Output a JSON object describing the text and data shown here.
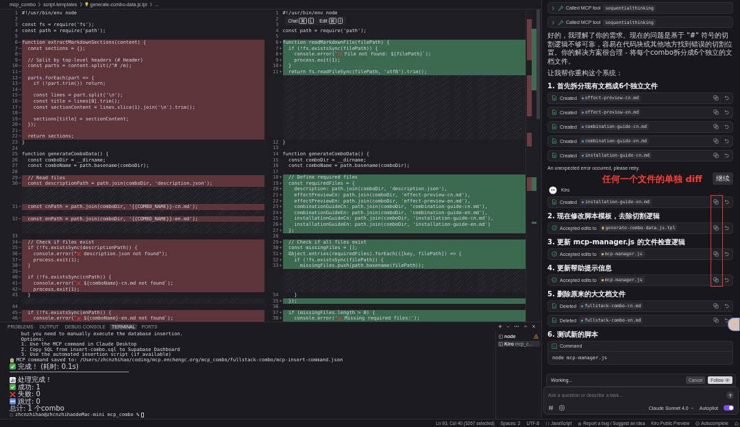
{
  "breadcrumb": [
    {
      "label": "mcp_combo",
      "kind": "folder"
    },
    {
      "label": "script-templates",
      "kind": "folder"
    },
    {
      "label": "generate-combo-data.js.tpl",
      "kind": "file"
    },
    {
      "label": "...",
      "kind": "more"
    }
  ],
  "diff": {
    "hint": [
      {
        "label": "Chat",
        "keys": [
          "⌘",
          "L"
        ]
      },
      {
        "label": "Edit",
        "keys": [
          "⌘",
          "I"
        ]
      }
    ],
    "rows": [
      {
        "left": {
          "num": "1",
          "kind": "same",
          "code": "#!/usr/bin/env node"
        },
        "right": {
          "num": "1",
          "kind": "same",
          "code": "#!/usr/bin/env node"
        }
      },
      {
        "left": {
          "num": "2",
          "kind": "same"
        },
        "right": {
          "num": "2",
          "kind": "same"
        }
      },
      {
        "left": {
          "num": "3",
          "kind": "same",
          "code": "const fs = require('fs');"
        },
        "right": {
          "num": "3",
          "kind": "same"
        }
      },
      {
        "left": {
          "num": "4",
          "kind": "same",
          "code": "const path = require('path');"
        },
        "right": {
          "num": "4",
          "kind": "same",
          "code": "const path = require('path');"
        }
      },
      {
        "left": {
          "num": "5",
          "kind": "same"
        },
        "right": {
          "num": "5",
          "kind": "same"
        }
      },
      {
        "left": {
          "num": "6",
          "sign": "−",
          "kind": "del",
          "code": "function extractMarkdownSections(content) {"
        },
        "right": {
          "num": "6",
          "sign": "+",
          "kind": "add",
          "code": "function readMarkdownFile(filePath) {"
        }
      },
      {
        "left": {
          "num": "7",
          "sign": "−",
          "kind": "del",
          "code": "  const sections = {};"
        },
        "right": {
          "num": "7",
          "sign": "+",
          "kind": "add",
          "code": "  if (!fs.existsSync(filePath)) {"
        }
      },
      {
        "left": {
          "num": "8",
          "sign": "−",
          "kind": "del"
        },
        "right": {
          "num": "8",
          "sign": "+",
          "kind": "add",
          "code": [
            "    console.error(`",
            " File not found: ${filePath}`);"
          ]
        }
      },
      {
        "left": {
          "num": "9",
          "sign": "−",
          "kind": "del",
          "code": "  // Split by top-level headers (# Header)"
        },
        "right": {
          "num": "9",
          "sign": "+",
          "kind": "add",
          "code": "    process.exit(1);"
        }
      },
      {
        "left": {
          "num": "10",
          "sign": "−",
          "kind": "del",
          "code": "  const parts = content.split(/^# /m);"
        },
        "right": {
          "num": "10",
          "sign": "+",
          "kind": "add",
          "code": "  }"
        }
      },
      {
        "left": {
          "num": "11",
          "sign": "−",
          "kind": "del"
        },
        "right": {
          "num": "11",
          "sign": "+",
          "kind": "add",
          "code": "  return fs.readFileSync(filePath, 'utf8').trim();"
        }
      },
      {
        "left": {
          "num": "12",
          "sign": "−",
          "kind": "del",
          "code": "  parts.forEach(part => {"
        },
        "right": null
      },
      {
        "left": {
          "num": "13",
          "sign": "−",
          "kind": "del",
          "code": "    if (!part.trim()) return;"
        },
        "right": null
      },
      {
        "left": {
          "num": "14",
          "sign": "−",
          "kind": "del"
        },
        "right": null
      },
      {
        "left": {
          "num": "15",
          "sign": "−",
          "kind": "del",
          "code": "    const lines = part.split('\\n');"
        },
        "right": null
      },
      {
        "left": {
          "num": "16",
          "sign": "−",
          "kind": "del",
          "code": "    const title = lines[0].trim();"
        },
        "right": null
      },
      {
        "left": {
          "num": "17",
          "sign": "−",
          "kind": "del",
          "code": "    const sectionContent = lines.slice(1).join('\\n').trim();"
        },
        "right": null
      },
      {
        "left": {
          "num": "18",
          "sign": "−",
          "kind": "del"
        },
        "right": null
      },
      {
        "left": {
          "num": "19",
          "sign": "−",
          "kind": "del",
          "code": "    sections[title] = sectionContent;"
        },
        "right": null
      },
      {
        "left": {
          "num": "20",
          "sign": "−",
          "kind": "del",
          "code": "  });"
        },
        "right": null
      },
      {
        "left": {
          "num": "21",
          "sign": "−",
          "kind": "del"
        },
        "right": null
      },
      {
        "left": {
          "num": "22",
          "sign": "−",
          "kind": "del",
          "code": "  return sections;"
        },
        "right": null
      },
      {
        "left": {
          "num": "23",
          "kind": "same",
          "code": "}"
        },
        "right": {
          "num": "12",
          "kind": "same",
          "code": "}"
        }
      },
      {
        "left": {
          "num": "24",
          "kind": "same"
        },
        "right": {
          "num": "13",
          "kind": "same"
        }
      },
      {
        "left": {
          "num": "25",
          "kind": "same",
          "code": "function generateComboData() {"
        },
        "right": {
          "num": "14",
          "kind": "same",
          "code": "function generateComboData() {"
        }
      },
      {
        "left": {
          "num": "26",
          "kind": "same",
          "code": "  const comboDir = __dirname;"
        },
        "right": {
          "num": "15",
          "kind": "same",
          "code": "  const comboDir = __dirname;"
        }
      },
      {
        "left": {
          "num": "27",
          "kind": "same",
          "code": "  const comboName = path.basename(comboDir);"
        },
        "right": {
          "num": "16",
          "kind": "same",
          "code": "  const comboName = path.basename(comboDir);"
        }
      },
      {
        "left": {
          "num": "28",
          "kind": "same"
        },
        "right": {
          "num": "17",
          "kind": "same"
        }
      },
      {
        "left": {
          "num": "29",
          "sign": "−",
          "kind": "del",
          "code": "  // Read files"
        },
        "right": {
          "num": "18",
          "sign": "+",
          "kind": "add",
          "code": "  // Define required files"
        }
      },
      {
        "left": {
          "num": "30",
          "sign": "−",
          "kind": "del",
          "code": "  const descriptionPath = path.join(comboDir, 'description.json');"
        },
        "right": {
          "num": "19",
          "sign": "+",
          "kind": "add",
          "code": "  const requiredFiles = {"
        }
      },
      {
        "left": null,
        "right": {
          "num": "20",
          "sign": "+",
          "kind": "add",
          "code": "    description: path.join(comboDir, 'description.json'),"
        }
      },
      {
        "left": null,
        "right": {
          "num": "21",
          "sign": "+",
          "kind": "add",
          "code": "    effectPreviewCn: path.join(comboDir, 'effect-preview-cn.md'),"
        }
      },
      {
        "left": null,
        "right": {
          "num": "22",
          "sign": "+",
          "kind": "add",
          "code": "    effectPreviewEn: path.join(comboDir, 'effect-preview-en.md'),"
        }
      },
      {
        "left": {
          "num": "31",
          "sign": "−",
          "kind": "del",
          "code": "  const cnPath = path.join(comboDir, '{{COMBO_NAME}}-cn.md');"
        },
        "right": {
          "num": "23",
          "sign": "+",
          "kind": "add",
          "code": "    combinationGuideCn: path.join(comboDir, 'combination-guide-cn.md'),"
        }
      },
      {
        "left": null,
        "right": {
          "num": "24",
          "sign": "+",
          "kind": "add",
          "code": "    combinationGuideEn: path.join(comboDir, 'combination-guide-en.md'),"
        }
      },
      {
        "left": {
          "num": "32",
          "sign": "−",
          "kind": "del",
          "code": "  const enPath = path.join(comboDir, '{{COMBO_NAME}}-en.md');"
        },
        "right": {
          "num": "25",
          "sign": "+",
          "kind": "add",
          "code": "    installationGuideCn: path.join(comboDir, 'installation-guide-cn.md'),"
        }
      },
      {
        "left": null,
        "right": {
          "num": "26",
          "sign": "+",
          "kind": "add",
          "code": "    installationGuideEn: path.join(comboDir, 'installation-guide-en.md')"
        }
      },
      {
        "left": null,
        "right": {
          "num": "27",
          "sign": "+",
          "kind": "add",
          "code": "  };"
        }
      },
      {
        "left": {
          "num": "33",
          "kind": "same"
        },
        "right": {
          "num": "28",
          "kind": "same"
        }
      },
      {
        "left": {
          "num": "34",
          "sign": "−",
          "kind": "del",
          "code": "  // Check if files exist"
        },
        "right": {
          "num": "29",
          "sign": "+",
          "kind": "add",
          "code": "  // Check if all files exist"
        }
      },
      {
        "left": {
          "num": "35",
          "sign": "−",
          "kind": "del",
          "code": "  if (!fs.existsSync(descriptionPath)) {"
        },
        "right": {
          "num": "30",
          "sign": "+",
          "kind": "add",
          "code": "  const missingFiles = [];"
        }
      },
      {
        "left": {
          "num": "36",
          "sign": "−",
          "kind": "del",
          "code": [
            "    console.error(\"",
            " description.json not found\");"
          ]
        },
        "right": {
          "num": "31",
          "sign": "+",
          "kind": "add",
          "code": "  Object.entries(requiredFiles).forEach(([key, filePath]) => {"
        }
      },
      {
        "left": {
          "num": "37",
          "sign": "−",
          "kind": "del",
          "code": "    process.exit(1);"
        },
        "right": {
          "num": "32",
          "sign": "+",
          "kind": "add",
          "code": "    if (!fs.existsSync(filePath)) {"
        }
      },
      {
        "left": {
          "num": "38",
          "sign": "−",
          "kind": "del",
          "code": "  }"
        },
        "right": {
          "num": "33",
          "sign": "+",
          "kind": "add",
          "code": "      missingFiles.push(path.basename(filePath));"
        }
      },
      {
        "left": {
          "num": "39",
          "sign": "−",
          "kind": "del"
        },
        "right": null
      },
      {
        "left": {
          "num": "40",
          "sign": "−",
          "kind": "del",
          "code": "  if (!fs.existsSync(cnPath)) {"
        },
        "right": null
      },
      {
        "left": {
          "num": "41",
          "sign": "−",
          "kind": "del",
          "code": [
            "    console.error(`",
            " ${comboName}-cn.md not found`);"
          ]
        },
        "right": null
      },
      {
        "left": {
          "num": "42",
          "sign": "−",
          "kind": "del",
          "code": "    process.exit(1);"
        },
        "right": null
      },
      {
        "left": {
          "num": "43",
          "kind": "same",
          "code": "  }"
        },
        "right": {
          "num": "34",
          "kind": "same",
          "code": "    }"
        }
      },
      {
        "left": null,
        "right": {
          "num": "35",
          "sign": "+",
          "kind": "add",
          "code": "  });"
        }
      },
      {
        "left": {
          "num": "44",
          "kind": "same"
        },
        "right": {
          "num": "36",
          "kind": "same"
        }
      },
      {
        "left": {
          "num": "45",
          "sign": "−",
          "kind": "del",
          "code": "  if (!fs.existsSync(enPath)) {"
        },
        "right": {
          "num": "37",
          "sign": "+",
          "kind": "add",
          "code": "  if (missingFiles.length > 0) {"
        }
      },
      {
        "left": {
          "num": "46",
          "sign": "−",
          "kind": "del",
          "code": [
            "    console.error(`",
            " ${comboName}-en.md not found`);"
          ]
        },
        "right": {
          "num": "38",
          "sign": "+",
          "kind": "add",
          "code": [
            "    console.error('",
            " Missing required files:');"
          ]
        }
      }
    ]
  },
  "terminal": {
    "tabs": [
      {
        "label": "PROBLEMS",
        "selected": false
      },
      {
        "label": "OUTPUT",
        "selected": false
      },
      {
        "label": "DEBUG CONSOLE",
        "selected": false
      },
      {
        "label": "TERMINAL",
        "selected": true
      },
      {
        "label": "PORTS",
        "selected": false
      }
    ],
    "lines": [
      {
        "kind": "output",
        "text": "    but you need to manually execute the database insertion."
      },
      {
        "kind": "output",
        "text": "    Options:"
      },
      {
        "kind": "output",
        "text": "    1. Use the MCP command in Claude Desktop"
      },
      {
        "kind": "output",
        "text": "    2. Copy SQL from insert-combo.sql to Supabase Dashboard"
      },
      {
        "kind": "output",
        "text": "    3. Use the automated insertion script (if available)"
      },
      {
        "kind": "saved",
        "text": "MCP command saved to: /Users/zhcnzhihao/coding/mcp.enchengc.org/mcp_combo/fullstack-combo/mcp-insert-command.json"
      },
      {
        "kind": "done",
        "text": "完成！ (耗时: 0.1s)"
      },
      {
        "kind": "rule"
      },
      {
        "kind": "blank"
      },
      {
        "kind": "summary",
        "text": "处理完成！"
      },
      {
        "kind": "success",
        "text": "成功: 1"
      },
      {
        "kind": "failure",
        "text": "失败: 0"
      },
      {
        "kind": "skipped",
        "text": "跳过: 0"
      },
      {
        "kind": "total",
        "text": "总计: 1 个combo"
      },
      {
        "kind": "prompt",
        "text": "zhcnzhihao@zhcnzhihaodeMac-mini mcp_combo %"
      }
    ],
    "sessions": [
      {
        "name": "node",
        "warning": true,
        "selected": false
      },
      {
        "name": "Kiro",
        "detail": "mcp_c…",
        "warning": false,
        "selected": true
      }
    ]
  },
  "chat": {
    "messages": [
      {
        "kind": "tool",
        "label": "Called MCP tool",
        "chip": "sequentialthinking"
      },
      {
        "kind": "tool",
        "label": "Called MCP tool",
        "chip": "sequentialthinking"
      },
      {
        "kind": "paragraph",
        "text": "好的，我理解了你的需求。现在的问题是基于 \"#\" 符号的切割逻辑不够可靠，容易在代码块或其他地方找到错误的切割位置。你的解决方案很合理 - 将每个combo拆分成6个独立的文档文件。"
      },
      {
        "kind": "paragraph",
        "text": "让我帮你重构这个系统："
      },
      {
        "kind": "heading",
        "text": "1. 首先拆分现有文档成6个独立文件"
      },
      {
        "kind": "created",
        "label": "Created",
        "file": {
          "kind": "markdown",
          "name": "effect-preview-cn.md"
        },
        "boxed": false
      },
      {
        "kind": "created",
        "label": "Created",
        "file": {
          "kind": "markdown",
          "name": "effect-preview-en.md"
        },
        "boxed": false
      },
      {
        "kind": "created",
        "label": "Created",
        "file": {
          "kind": "markdown",
          "name": "combination-guide-cn.md"
        },
        "boxed": false
      },
      {
        "kind": "created",
        "label": "Created",
        "file": {
          "kind": "markdown",
          "name": "combination-guide-en.md"
        },
        "boxed": false
      },
      {
        "kind": "created",
        "label": "Created",
        "file": {
          "kind": "markdown",
          "name": "installation-guide-cn.md"
        },
        "boxed": false
      },
      {
        "kind": "error",
        "text": "An unexpected error occurred, please retry."
      },
      {
        "kind": "continue",
        "annotation": "任何一个文件的单独 diff",
        "button": "继续"
      },
      {
        "kind": "author",
        "text": "Kiro"
      },
      {
        "kind": "created",
        "label": "Created",
        "file": {
          "kind": "markdown",
          "name": "installation-guide-en.md"
        },
        "boxed": true
      },
      {
        "kind": "heading",
        "text": "2. 现在修改脚本模板，去除切割逻辑"
      },
      {
        "kind": "accepted",
        "label": "Accepted edits to",
        "file": {
          "kind": "template",
          "name": "generate-combo-data.js.tpl"
        },
        "boxed": true
      },
      {
        "kind": "heading",
        "text": "3. 更新 mcp-manager.js 的文件检查逻辑"
      },
      {
        "kind": "accepted",
        "label": "Accepted edits to",
        "file": {
          "kind": "script",
          "name": "mcp-manager.js"
        },
        "boxed": true
      },
      {
        "kind": "heading",
        "text": "4. 更新帮助提示信息"
      },
      {
        "kind": "accepted",
        "label": "Accepted edits to",
        "file": {
          "kind": "script",
          "name": "mcp-manager.js"
        },
        "boxed": true
      },
      {
        "kind": "heading",
        "text": "5. 删除原来的大文档文件"
      },
      {
        "kind": "deleted",
        "label": "Deleted",
        "file": {
          "kind": "markdown",
          "name": "fullstack-combo-cn.md"
        },
        "boxed": false
      },
      {
        "kind": "deleted",
        "label": "Deleted",
        "file": {
          "kind": "markdown",
          "name": "fullstack-combo-en.md"
        },
        "boxed": false
      },
      {
        "kind": "heading",
        "text": "6. 测试新的脚本"
      },
      {
        "kind": "command",
        "title": "Command",
        "code": "node mcp-manager.js"
      }
    ],
    "composer": {
      "status": "Working...",
      "actions": [
        {
          "label": "Cancel",
          "kind": "cancel"
        },
        {
          "label": "Follow",
          "kind": "follow"
        }
      ],
      "placeholder": "Ask a question or describe a task...",
      "model": "Claude Sonnet 4.0",
      "autopilot": {
        "label": "Autopilot",
        "on": true
      }
    }
  },
  "status_bar": [
    {
      "text": "Ln 93, Col 40 (3267 selected)",
      "kind": "plain"
    },
    {
      "text": "Spaces: 2",
      "kind": "plain"
    },
    {
      "text": "UTF-8",
      "kind": "plain"
    },
    {
      "text": "JavaScript",
      "kind": "language"
    },
    {
      "text": "Report a bug / Suggest an idea",
      "kind": "feedback"
    },
    {
      "text": "Kiro Public Preview",
      "kind": "plain"
    },
    {
      "text": "Autocomplete",
      "kind": "toggle"
    }
  ]
}
